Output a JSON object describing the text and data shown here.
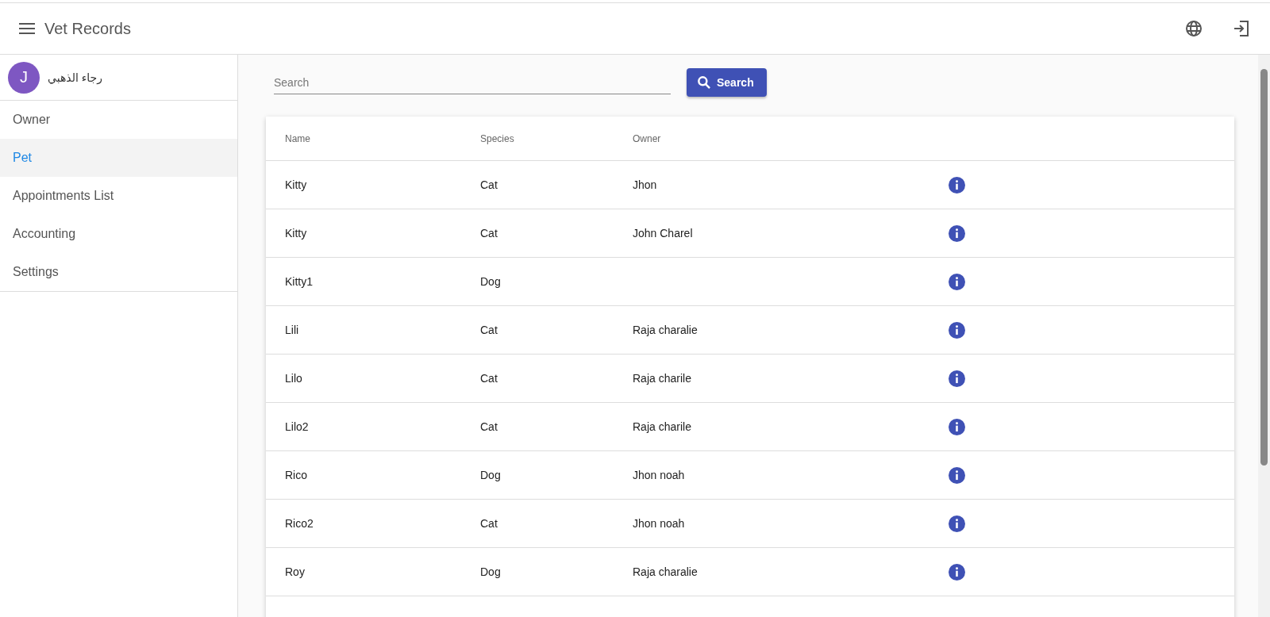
{
  "app_bar": {
    "title": "Vet Records"
  },
  "user": {
    "initial": "J",
    "name": "رجاء الذهبي"
  },
  "sidebar": {
    "items": [
      {
        "label": "Owner",
        "selected": false
      },
      {
        "label": "Pet",
        "selected": true
      },
      {
        "label": "Appointments List",
        "selected": false
      },
      {
        "label": "Accounting",
        "selected": false
      },
      {
        "label": "Settings",
        "selected": false
      }
    ]
  },
  "search": {
    "placeholder": "Search",
    "button": "Search"
  },
  "table": {
    "columns": [
      "Name",
      "Species",
      "Owner"
    ],
    "rows": [
      {
        "name": "Kitty",
        "species": "Cat",
        "owner": "Jhon"
      },
      {
        "name": "Kitty",
        "species": "Cat",
        "owner": "John Charel"
      },
      {
        "name": "Kitty1",
        "species": "Dog",
        "owner": ""
      },
      {
        "name": "Lili",
        "species": "Cat",
        "owner": "Raja charalie"
      },
      {
        "name": "Lilo",
        "species": "Cat",
        "owner": "Raja charile"
      },
      {
        "name": "Lilo2",
        "species": "Cat",
        "owner": "Raja charile"
      },
      {
        "name": "Rico",
        "species": "Dog",
        "owner": "Jhon noah"
      },
      {
        "name": "Rico2",
        "species": "Cat",
        "owner": "Jhon noah"
      },
      {
        "name": "Roy",
        "species": "Dog",
        "owner": "Raja charalie"
      }
    ]
  }
}
